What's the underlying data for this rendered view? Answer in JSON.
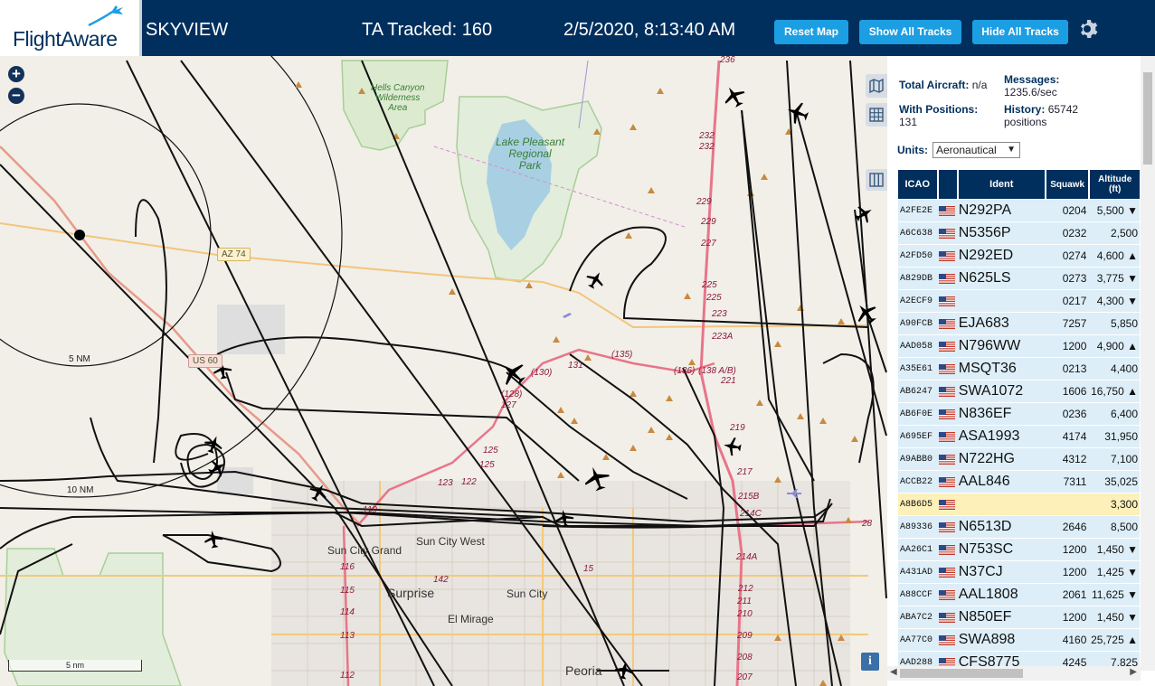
{
  "header": {
    "logo": "FlightAware",
    "title": "SKYVIEW",
    "ta_tracked": "TA Tracked: 160",
    "clock": "2/5/2020, 8:13:40 AM",
    "buttons": {
      "reset": "Reset Map",
      "show_all": "Show All Tracks",
      "hide_all": "Hide All Tracks"
    }
  },
  "map": {
    "zoom_in": "+",
    "zoom_out": "−",
    "scale": "5 nm",
    "info": "i",
    "labels": {
      "hells_canyon": "Hells Canyon\nWilderness\nArea",
      "lake_pleasant": "Lake Pleasant\nRegional\nPark",
      "az74": "AZ 74",
      "us60": "US 60",
      "ring_5": "5 NM",
      "ring_10": "10 NM",
      "sun_city_grand": "Sun City Grand",
      "sun_city_west": "Sun City West",
      "surprise": "Surprise",
      "sun_city": "Sun City",
      "el_mirage": "El Mirage",
      "peoria": "Peoria",
      "exit_131": "131",
      "exit_130": "(130)",
      "exit_135": "(135)",
      "exit_136": "(136)",
      "exit_138": "(138 A/B)",
      "exit_128": "(128)",
      "exit_127": "127",
      "exit_125a": "125",
      "exit_125b": "125",
      "exit_123": "123",
      "exit_122": "122",
      "exit_119": "119",
      "exit_116": "116",
      "exit_115": "115",
      "exit_114": "114",
      "exit_113": "113",
      "exit_112": "112",
      "exit_142": "142",
      "exit_15": "15",
      "i17_236": "236",
      "i17_232a": "232",
      "i17_232b": "232",
      "i17_229a": "229",
      "i17_229b": "229",
      "i17_227": "227",
      "i17_225a": "225",
      "i17_225b": "225",
      "i17_223": "223",
      "i17_223a": "223A",
      "i17_221": "221",
      "i17_219": "219",
      "i17_217": "217",
      "i17_215b": "215B",
      "i17_214c": "214C",
      "i17_214a": "214A",
      "i17_212": "212",
      "i17_211": "211",
      "i17_210": "210",
      "i17_209": "209",
      "i17_208": "208",
      "i17_207": "207",
      "i17_28": "28"
    }
  },
  "stats": {
    "total_label": "Total Aircraft:",
    "total_value": "n/a",
    "positions_label": "With Positions:",
    "positions_value": "131",
    "messages_label": "Messages:",
    "messages_value": "1235.6/sec",
    "history_label": "History:",
    "history_value": "65742",
    "history_unit": "positions"
  },
  "units": {
    "label": "Units:",
    "selected": "Aeronautical"
  },
  "table": {
    "headers": {
      "icao": "ICAO",
      "flag": "",
      "ident": "Ident",
      "squawk": "Squawk",
      "altitude": "Altitude\n(ft)"
    },
    "rows": [
      {
        "icao": "A2FE2E",
        "ident": "N292PA",
        "squawk": "0204",
        "alt": "5,500 ▼"
      },
      {
        "icao": "A6C638",
        "ident": "N5356P",
        "squawk": "0232",
        "alt": "2,500"
      },
      {
        "icao": "A2FD50",
        "ident": "N292ED",
        "squawk": "0274",
        "alt": "4,600 ▲"
      },
      {
        "icao": "A829DB",
        "ident": "N625LS",
        "squawk": "0273",
        "alt": "3,775 ▼"
      },
      {
        "icao": "A2ECF9",
        "ident": "",
        "squawk": "0217",
        "alt": "4,300 ▼"
      },
      {
        "icao": "A90FCB",
        "ident": "EJA683",
        "squawk": "7257",
        "alt": "5,850"
      },
      {
        "icao": "AAD058",
        "ident": "N796WW",
        "squawk": "1200",
        "alt": "4,900 ▲"
      },
      {
        "icao": "A35E61",
        "ident": "MSQT36",
        "squawk": "0213",
        "alt": "4,400"
      },
      {
        "icao": "AB6247",
        "ident": "SWA1072",
        "squawk": "1606",
        "alt": "16,750 ▲"
      },
      {
        "icao": "AB6F0E",
        "ident": "N836EF",
        "squawk": "0236",
        "alt": "6,400"
      },
      {
        "icao": "A695EF",
        "ident": "ASA1993",
        "squawk": "4174",
        "alt": "31,950"
      },
      {
        "icao": "A9ABB0",
        "ident": "N722HG",
        "squawk": "4312",
        "alt": "7,100"
      },
      {
        "icao": "ACCB22",
        "ident": "AAL846",
        "squawk": "7311",
        "alt": "35,025"
      },
      {
        "icao": "A8B6D5",
        "ident": "",
        "squawk": "",
        "alt": "3,300",
        "highlight": true
      },
      {
        "icao": "A89336",
        "ident": "N6513D",
        "squawk": "2646",
        "alt": "8,500"
      },
      {
        "icao": "AA26C1",
        "ident": "N753SC",
        "squawk": "1200",
        "alt": "1,450 ▼"
      },
      {
        "icao": "A431AD",
        "ident": "N37CJ",
        "squawk": "1200",
        "alt": "1,425 ▼"
      },
      {
        "icao": "A88CCF",
        "ident": "AAL1808",
        "squawk": "2061",
        "alt": "11,625 ▼"
      },
      {
        "icao": "ABA7C2",
        "ident": "N850EF",
        "squawk": "1200",
        "alt": "1,450 ▼"
      },
      {
        "icao": "AA77C0",
        "ident": "SWA898",
        "squawk": "4160",
        "alt": "25,725 ▲"
      },
      {
        "icao": "AAD288",
        "ident": "CFS8775",
        "squawk": "4245",
        "alt": "7,825"
      }
    ]
  },
  "colors": {
    "header_bg": "#002f5d",
    "button_bg": "#1c9ee3",
    "row_bg": "#ddeef8",
    "row_highlight": "#fdf0b9"
  }
}
